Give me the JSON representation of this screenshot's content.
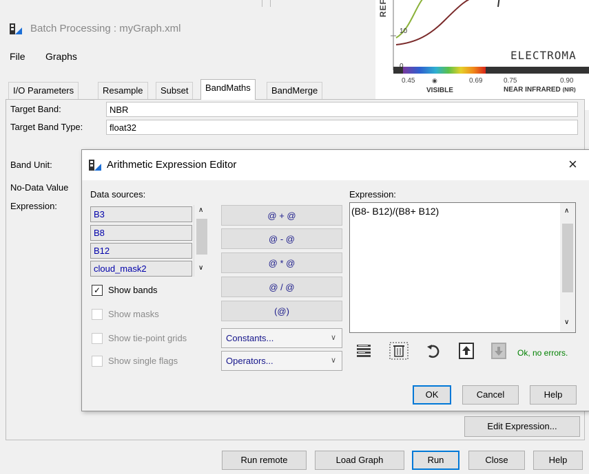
{
  "main_window": {
    "title": "Batch Processing : myGraph.xml",
    "menu": [
      "File",
      "Graphs"
    ],
    "tabs": [
      "I/O Parameters",
      "Resample",
      "Subset",
      "BandMaths",
      "BandMerge"
    ],
    "active_tab": "BandMaths",
    "fields": {
      "target_band_label": "Target Band:",
      "target_band_value": "NBR",
      "target_band_type_label": "Target Band Type:",
      "target_band_type_value": "float32",
      "band_unit_label": "Band Unit:",
      "no_data_label": "No-Data Value",
      "expression_label": "Expression:"
    },
    "edit_expression_button": "Edit Expression...",
    "bottom_buttons": {
      "run_remote": "Run remote",
      "load_graph": "Load Graph",
      "run": "Run",
      "close": "Close",
      "help": "Help"
    }
  },
  "spectrum_graphic": {
    "axis_tick_top": "10",
    "axis_tick_bottom": "0",
    "partial_label": "REF",
    "title": "ELECTROMA",
    "ticks": [
      "0.45",
      "0.69",
      "0.75",
      "0.90"
    ],
    "visible_label": "VISIBLE",
    "nir_label": "NEAR INFRARED",
    "nir_abbrev": "(NIR)"
  },
  "dialog": {
    "title": "Arithmetic Expression Editor",
    "data_sources_label": "Data sources:",
    "data_sources": [
      "B3",
      "B8",
      "B12",
      "cloud_mask2"
    ],
    "operator_buttons": [
      "@ + @",
      "@ - @",
      "@ * @",
      "@ / @",
      "(@)"
    ],
    "constants_label": "Constants...",
    "operators_label": "Operators...",
    "checkboxes": [
      {
        "label": "Show bands",
        "checked": true,
        "enabled": true
      },
      {
        "label": "Show masks",
        "checked": false,
        "enabled": false
      },
      {
        "label": "Show tie-point grids",
        "checked": false,
        "enabled": false
      },
      {
        "label": "Show single flags",
        "checked": false,
        "enabled": false
      }
    ],
    "expression_label": "Expression:",
    "expression_value": "(B8- B12)/(B8+ B12)",
    "status": "Ok, no errors.",
    "status_color": "#008000",
    "buttons": {
      "ok": "OK",
      "cancel": "Cancel",
      "help": "Help"
    },
    "icons": [
      "code-list-icon",
      "delete-icon",
      "refresh-icon",
      "import-icon",
      "export-icon"
    ]
  }
}
